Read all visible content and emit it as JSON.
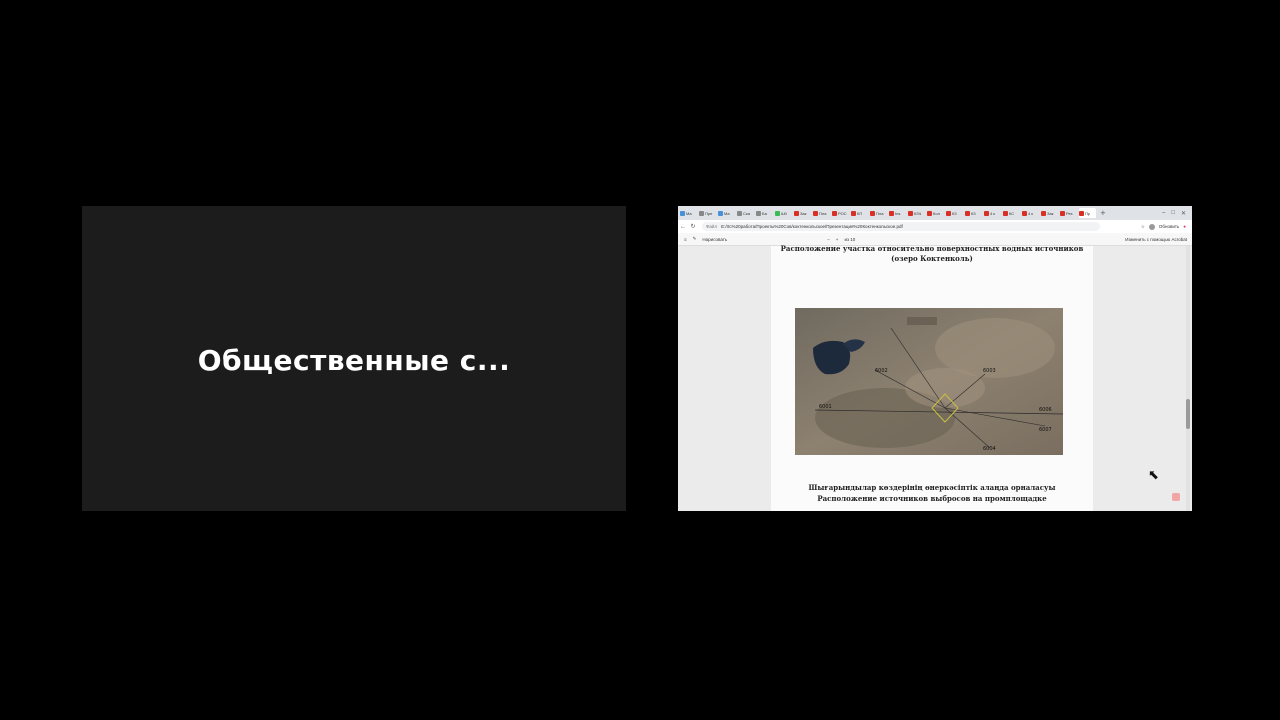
{
  "participant": {
    "name": "Общественные  с..."
  },
  "browser": {
    "tabs": [
      {
        "label": "Ма",
        "color": "#4a90d9"
      },
      {
        "label": "Пре",
        "color": "#888888"
      },
      {
        "label": "Ма",
        "color": "#4a90d9"
      },
      {
        "label": "Ска",
        "color": "#888888"
      },
      {
        "label": "Ба",
        "color": "#888888"
      },
      {
        "label": "Ш0",
        "color": "#3cba54"
      },
      {
        "label": "Зак",
        "color": "#d93025"
      },
      {
        "label": "Пла",
        "color": "#d93025"
      },
      {
        "label": "РОС",
        "color": "#d93025"
      },
      {
        "label": "КП",
        "color": "#d93025"
      },
      {
        "label": "Пла",
        "color": "#d93025"
      },
      {
        "label": "Ins",
        "color": "#d93025"
      },
      {
        "label": "КЗЧ",
        "color": "#d93025"
      },
      {
        "label": "Кол",
        "color": "#d93025"
      },
      {
        "label": "КЗ",
        "color": "#d93025"
      },
      {
        "label": "КЗ",
        "color": "#d93025"
      },
      {
        "label": "4 к",
        "color": "#d93025"
      },
      {
        "label": "КС",
        "color": "#d93025"
      },
      {
        "label": "4 к",
        "color": "#d93025"
      },
      {
        "label": "Зак",
        "color": "#d93025"
      },
      {
        "label": "Рез",
        "color": "#d93025"
      },
      {
        "label": "Пр",
        "color": "#d93025",
        "active": true
      }
    ],
    "address_label": "Файл",
    "url": "E:/rtc%20работа/Проекты%20Сов/коктенкольское/Презентация%20Коктенкольское.pdf",
    "update_button": "Обновить",
    "pdf_toolbar": {
      "draw_label": "Нарисовать",
      "page_count": "из 10",
      "edit_label": "Изменить с помощью Acrobat"
    }
  },
  "pdf": {
    "title_line1": "Расположение участка относительно поверхностных водных источников",
    "title_line2": "(озеро Коктенколь)",
    "caption_line1": "Шығарындылар көздерінің өнеркәсіптік алаңда орналасуы",
    "caption_line2": "Расположение источников выбросов на промплощадке",
    "map_labels": {
      "l1": "6002",
      "l2": "6001",
      "l3": "6003",
      "l4": "6004",
      "l5": "6006",
      "l6": "6007"
    }
  }
}
